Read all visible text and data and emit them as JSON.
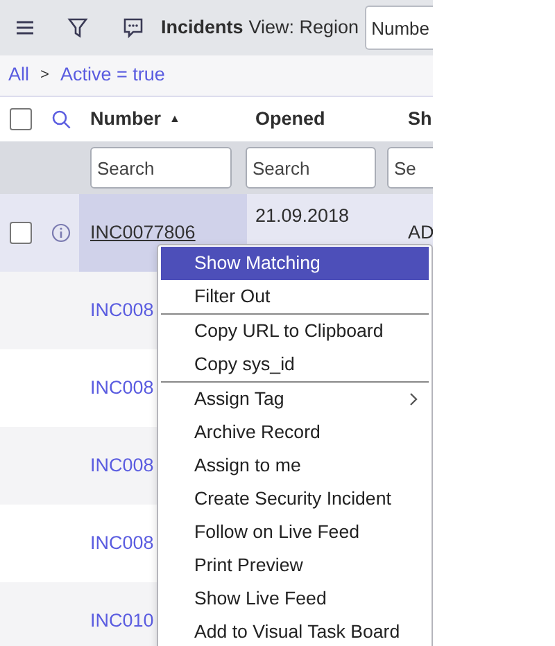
{
  "header": {
    "title": "Incidents",
    "view": "View: Region",
    "search_field_value": "Numbe"
  },
  "breadcrumb": [
    "All",
    ">",
    "Active = true"
  ],
  "select_all": {
    "checked": false
  },
  "columns": [
    {
      "label": "Number",
      "sort_indicator": "▲"
    },
    {
      "label": "Opened"
    },
    {
      "label": "Sh"
    }
  ],
  "search_placeholders": [
    "Search",
    "Search",
    "Se"
  ],
  "rows": [
    {
      "number": "INC0077806",
      "opened": "21.09.2018",
      "column_3": "AD",
      "selected": true,
      "checked": false
    },
    {
      "number": "INC008",
      "selected": false
    },
    {
      "number": "INC008",
      "selected": false
    },
    {
      "number": "INC008",
      "selected": false
    },
    {
      "number": "INC008",
      "selected": false
    },
    {
      "number": "INC010",
      "selected": false
    }
  ],
  "context_menu": [
    {
      "kind": "item",
      "label": "Show Matching",
      "selected": true,
      "submenu": false
    },
    {
      "kind": "item",
      "label": "Filter Out",
      "selected": false,
      "submenu": false
    },
    {
      "kind": "separator"
    },
    {
      "kind": "item",
      "label": "Copy URL to Clipboard",
      "selected": false,
      "submenu": false
    },
    {
      "kind": "item",
      "label": "Copy sys_id",
      "selected": false,
      "submenu": false
    },
    {
      "kind": "separator"
    },
    {
      "kind": "item",
      "label": "Assign Tag",
      "selected": false,
      "submenu": true
    },
    {
      "kind": "item",
      "label": "Archive Record",
      "selected": false,
      "submenu": false
    },
    {
      "kind": "item",
      "label": "Assign to me",
      "selected": false,
      "submenu": false
    },
    {
      "kind": "item",
      "label": "Create Security Incident",
      "selected": false,
      "submenu": false
    },
    {
      "kind": "item",
      "label": "Follow on Live Feed",
      "selected": false,
      "submenu": false
    },
    {
      "kind": "item",
      "label": "Print Preview",
      "selected": false,
      "submenu": false
    },
    {
      "kind": "item",
      "label": "Show Live Feed",
      "selected": false,
      "submenu": false
    },
    {
      "kind": "item",
      "label": "Add to Visual Task Board",
      "selected": false,
      "submenu": false
    }
  ]
}
